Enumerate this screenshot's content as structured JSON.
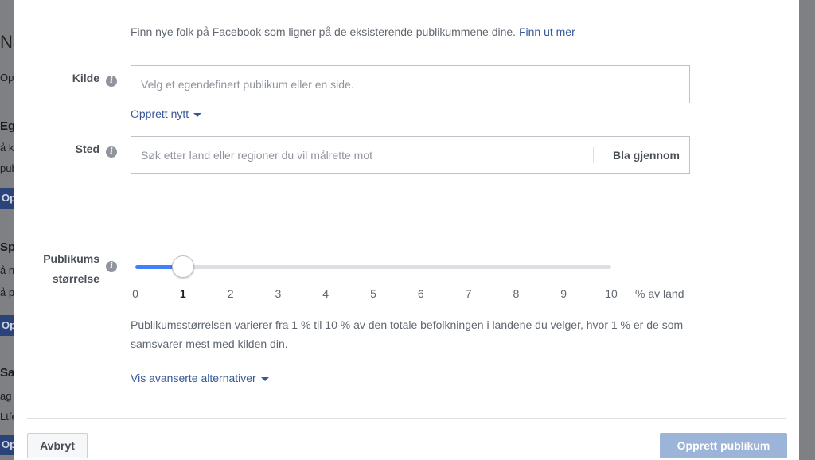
{
  "background": {
    "fragments": [
      "Nå",
      "Opp",
      "Ege",
      "å k",
      "publ",
      "Op",
      "Spe",
      "å n",
      "å p",
      "Op",
      "Sag",
      "ag",
      "Ltfe",
      "Op"
    ]
  },
  "intro": {
    "text": "Finn nye folk på Facebook som ligner på de eksisterende publikummene dine.",
    "link": "Finn ut mer"
  },
  "source": {
    "label": "Kilde",
    "info_icon": "info-icon",
    "placeholder": "Velg et egendefinert publikum eller en side.",
    "create_new": "Opprett nytt"
  },
  "location": {
    "label": "Sted",
    "info_icon": "info-icon",
    "placeholder": "Søk etter land eller regioner du vil målrette mot",
    "browse": "Bla gjennom"
  },
  "audience_size": {
    "label_line1": "Publikums",
    "label_line2": "størrelse",
    "info_icon": "info-icon",
    "value": 1,
    "min": 0,
    "max": 10,
    "ticks": [
      "0",
      "1",
      "2",
      "3",
      "4",
      "5",
      "6",
      "7",
      "8",
      "9",
      "10"
    ],
    "unit": "% av land",
    "description": "Publikumsstørrelsen varierer fra 1 % til 10 % av den totale befolkningen i landene du velger, hvor 1 % er de som samsvarer mest med kilden din."
  },
  "advanced": {
    "label": "Vis avanserte alternativer"
  },
  "footer": {
    "cancel": "Avbryt",
    "create": "Opprett publikum"
  },
  "colors": {
    "link": "#365899",
    "slider_fill": "#4080ff",
    "primary_disabled": "#9cb4d8"
  }
}
